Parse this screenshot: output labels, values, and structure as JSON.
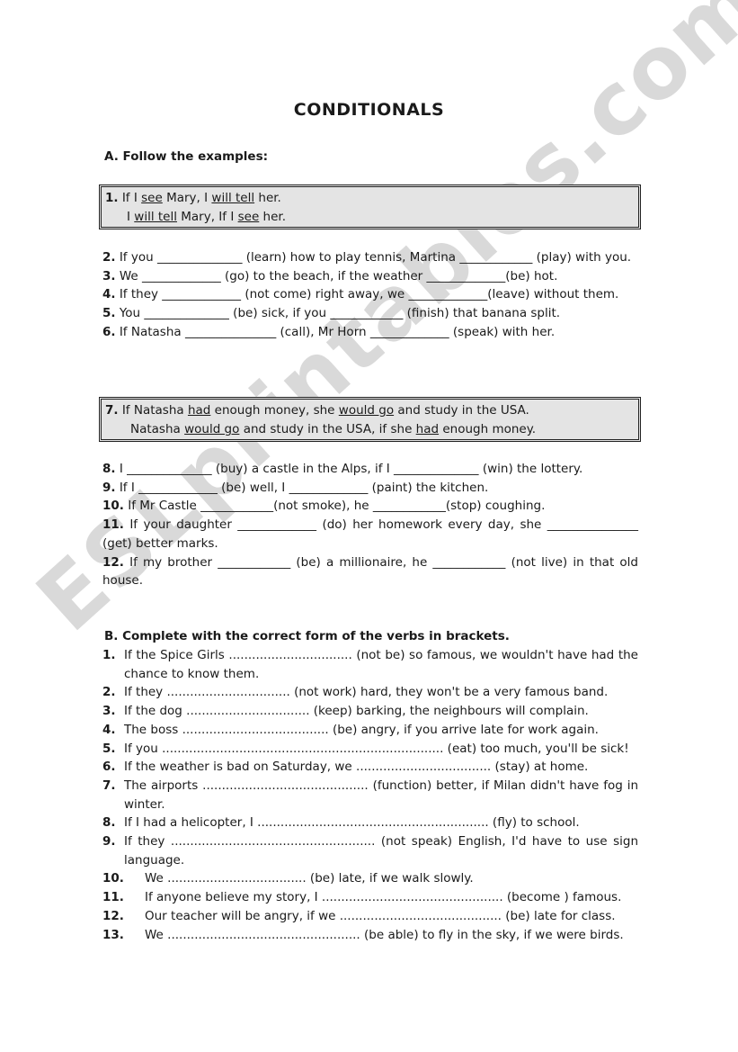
{
  "title": "CONDITIONALS",
  "watermark": "ESLprintables.com",
  "section_a": {
    "heading": "A.  Follow the examples:",
    "example1": {
      "num": "1.",
      "line1": [
        "If I ",
        "see",
        " Mary, I ",
        "will tell",
        " her."
      ],
      "line2": [
        "I ",
        "will tell",
        " Mary, If I ",
        "see",
        " her."
      ]
    },
    "items_part1": [
      {
        "num": "2.",
        "text": " If you ______________ (learn) how to play tennis, Martina ____________ (play) with you."
      },
      {
        "num": "3.",
        "text": " We _____________ (go) to the beach, if the weather _____________(be) hot."
      },
      {
        "num": "4.",
        "text": " If they _____________ (not come) right away, we _____________(leave) without them."
      },
      {
        "num": "5.",
        "text": " You ______________ (be) sick, if you ____________ (finish) that banana split."
      },
      {
        "num": "6.",
        "text": " If Natasha _______________ (call), Mr Horn _____________ (speak) with her."
      }
    ],
    "example7": {
      "num": "7.",
      "line1": [
        " If Natasha ",
        "had",
        " enough money, she ",
        "would go",
        " and study in the USA."
      ],
      "line2": [
        "Natasha ",
        "would go",
        " and study in the USA,  if she ",
        "had",
        " enough money."
      ]
    },
    "items_part2": [
      {
        "num": "8.",
        "text": " I ______________ (buy) a castle in the Alps, if I ______________ (win) the lottery."
      },
      {
        "num": "9.",
        "text": " If I _____________ (be) well, I _____________ (paint) the kitchen."
      },
      {
        "num": "10.",
        "text": " If Mr Castle ____________(not smoke), he ____________(stop) coughing."
      },
      {
        "num": "11.",
        "text": " If your daughter _____________ (do) her homework every day, she _______________ (get) better marks."
      },
      {
        "num": "12.",
        "text": " If my brother ____________ (be) a millionaire, he ____________ (not live) in that old house."
      }
    ]
  },
  "section_b": {
    "heading": "B.  Complete with the correct form of the verbs in brackets.",
    "items": [
      {
        "num": "1.",
        "text": "If the Spice Girls ................................ (not be) so famous, we wouldn't have had the chance to know them."
      },
      {
        "num": "2.",
        "text": "If they ................................ (not work) hard, they won't be a very famous band."
      },
      {
        "num": "3.",
        "text": "If the dog ................................ (keep) barking, the neighbours will complain."
      },
      {
        "num": "4.",
        "text": "The boss ...................................... (be) angry, if you arrive late for work again."
      },
      {
        "num": "5.",
        "text": "If you ......................................................................... (eat) too much,  you'll be sick!"
      },
      {
        "num": "6.",
        "text": "If the weather is bad on Saturday, we ................................... (stay) at home."
      },
      {
        "num": "7.",
        "text": "The airports ........................................... (function) better, if Milan didn't have fog in winter."
      },
      {
        "num": "8.",
        "text": "If I had a helicopter, I ............................................................ (fly) to school."
      },
      {
        "num": "9.",
        "text": "If they ..................................................... (not speak) English, I'd have to use sign language."
      },
      {
        "num": "10.",
        "text": "We .................................... (be) late, if we walk slowly."
      },
      {
        "num": "11.",
        "text": "If anyone believe my story, I ............................................... (become ) famous."
      },
      {
        "num": "12.",
        "text": "Our teacher will be angry, if we .......................................... (be) late for class."
      },
      {
        "num": "13.",
        "text": "We .................................................. (be able) to fly in the sky, if we were birds."
      }
    ]
  }
}
